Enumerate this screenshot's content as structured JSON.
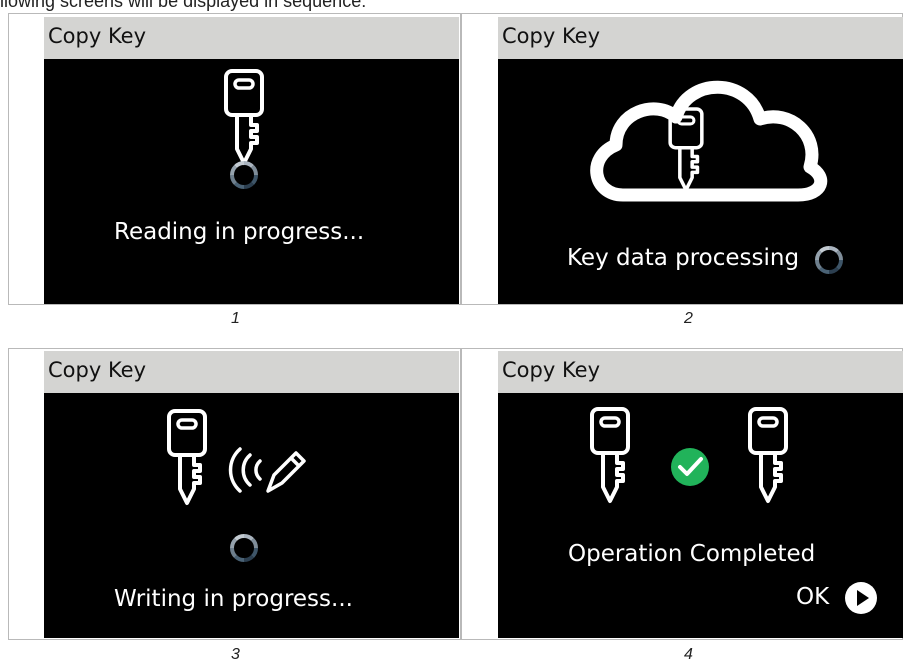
{
  "intro_text": "llowing screens will be displayed in sequence:",
  "screens": [
    {
      "title": "Copy Key",
      "message": "Reading in progress...",
      "caption": "1",
      "icons": [
        "key-icon",
        "loading-spinner-icon"
      ]
    },
    {
      "title": "Copy Key",
      "message": "Key data processing",
      "caption": "2",
      "icons": [
        "cloud-icon",
        "key-icon",
        "loading-spinner-icon"
      ]
    },
    {
      "title": "Copy Key",
      "message": "Writing in progress...",
      "caption": "3",
      "icons": [
        "key-icon",
        "signal-waves-icon",
        "pencil-icon",
        "loading-spinner-icon"
      ]
    },
    {
      "title": "Copy Key",
      "message": "Operation Completed",
      "ok_label": "OK",
      "caption": "4",
      "icons": [
        "key-icon",
        "check-circle-icon",
        "key-icon",
        "play-circle-icon"
      ]
    }
  ],
  "colors": {
    "screen_bg": "#000000",
    "title_bar": "#d4d4d2",
    "check_green": "#21b35a",
    "spinner_dark": "#3e5568",
    "spinner_light": "#aab4bf"
  }
}
